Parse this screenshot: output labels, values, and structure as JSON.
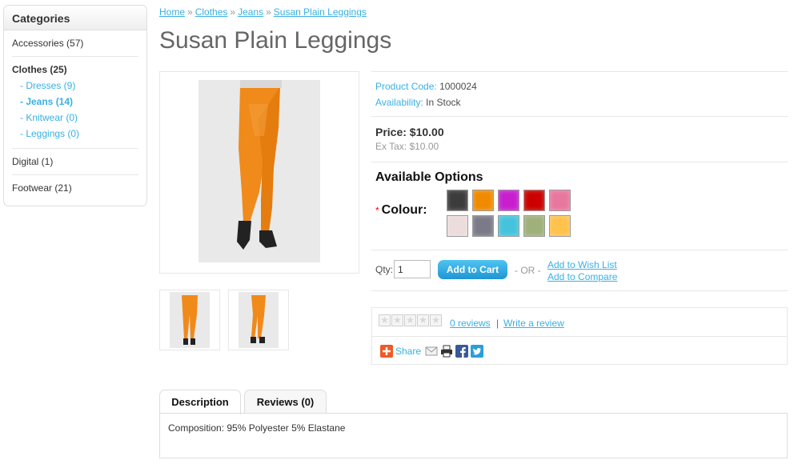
{
  "sidebar": {
    "heading": "Categories",
    "groups": [
      {
        "label": "Accessories (57)",
        "children": []
      },
      {
        "label": "Clothes (25)",
        "children": [
          "- Dresses (9)",
          "- Jeans (14)",
          "- Knitwear (0)",
          "- Leggings (0)"
        ]
      },
      {
        "label": "Digital (1)",
        "children": []
      },
      {
        "label": "Footwear (21)",
        "children": []
      }
    ]
  },
  "breadcrumb": [
    "Home",
    "Clothes",
    "Jeans",
    "Susan Plain Leggings"
  ],
  "breadcrumb_sep": "»",
  "product": {
    "title": "Susan Plain Leggings",
    "code_label": "Product Code:",
    "code": "1000024",
    "availability_label": "Availability:",
    "availability": "In Stock",
    "price": "Price: $10.00",
    "ex_tax": "Ex Tax: $10.00"
  },
  "options": {
    "heading": "Available Options",
    "required_mark": "*",
    "colour_label": "Colour:",
    "swatches": [
      "#3c3c3c",
      "#f08a00",
      "#c81ecf",
      "#cc0000",
      "#e8779d",
      "#ecdcdc",
      "#7a7a88",
      "#46c3dc",
      "#9fb07a",
      "#ffc24d"
    ]
  },
  "cart": {
    "qty_label": "Qty:",
    "qty_value": "1",
    "add_button": "Add to Cart",
    "or_text": "- OR -",
    "wishlist": "Add to Wish List",
    "compare": "Add to Compare"
  },
  "review": {
    "stars": 0,
    "reviews_link": "0 reviews",
    "separator": "|",
    "write_link": "Write a review",
    "share_label": "Share"
  },
  "tabs": {
    "items": [
      "Description",
      "Reviews (0)"
    ],
    "content": "Composition: 95% Polyester 5% Elastane"
  }
}
